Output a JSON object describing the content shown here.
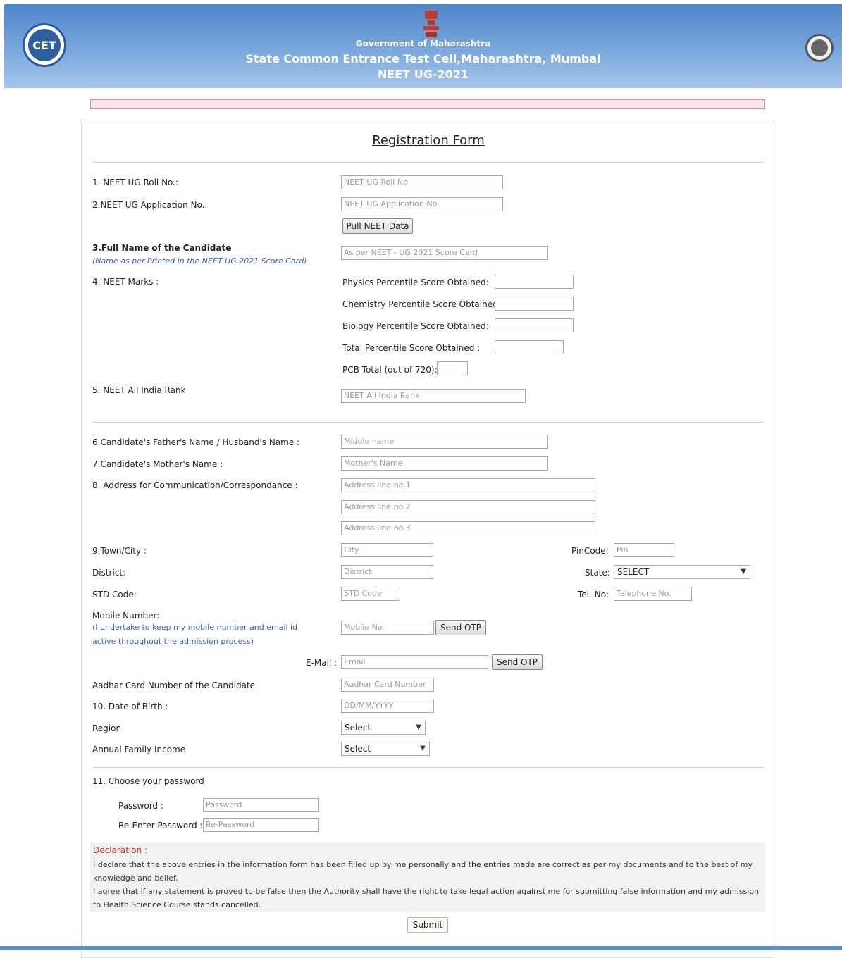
{
  "header": {
    "line1": "Government of Maharashtra",
    "line2": "State Common Entrance Test Cell,Maharashtra, Mumbai",
    "line3": "NEET UG-2021",
    "logo_text": "CET"
  },
  "form": {
    "title": "Registration Form",
    "roll_label": "1. NEET UG Roll No.:",
    "roll_placeholder": "NEET UG Roll No",
    "appno_label": "2.NEET UG Application No.:",
    "appno_placeholder": "NEET UG Application No",
    "pull_button": "Pull NEET Data",
    "fullname_label": "3.Full Name of the Candidate",
    "fullname_note": "(Name as per Printed in the NEET UG 2021 Score Card)",
    "fullname_placeholder": "As per NEET - UG 2021 Score Card",
    "marks_label": "4. NEET Marks :",
    "physics_label": "Physics Percentile Score Obtained:",
    "chemistry_label": "Chemistry Percentile Score Obtained:",
    "biology_label": "Biology Percentile Score Obtained:",
    "total_label": "Total Percentile Score Obtained :",
    "pcb_label": "PCB Total (out of 720):",
    "rank_label": "5. NEET All India Rank",
    "rank_placeholder": "NEET All India Rank",
    "father_label": "6.Candidate's Father's Name / Husband's Name :",
    "father_placeholder": "Middle name",
    "mother_label": "7.Candidate's Mother's Name :",
    "mother_placeholder": "Mother's Name",
    "address_label": "8. Address for Communication/Correspondance :",
    "address1_placeholder": "Address line no.1",
    "address2_placeholder": "Address line no.2",
    "address3_placeholder": "Address line no.3",
    "city_label": "9.Town/City :",
    "city_placeholder": "City",
    "pincode_label": "PinCode:",
    "pincode_placeholder": "Pin",
    "district_label": "District:",
    "district_placeholder": "District",
    "state_label": "State:",
    "state_value": "SELECT",
    "std_label": "STD Code:",
    "std_placeholder": "STD Code",
    "tel_label": "Tel. No:",
    "tel_placeholder": "Telephone No.",
    "mobile_label": "Mobile Number:",
    "mobile_note": "(I undertake to keep my mobile number and email id active throughout the admission process)",
    "mobile_placeholder": "Mobile No.",
    "send_otp": "Send OTP",
    "email_label": "E-Mail :",
    "email_placeholder": "Email",
    "aadhar_label": "Aadhar Card Number of the Candidate",
    "aadhar_placeholder": "Aadhar Card Number",
    "dob_label": "10. Date of Birth :",
    "dob_placeholder": "DD/MM/YYYY",
    "region_label": "Region",
    "region_value": "Select",
    "income_label": "Annual Family Income",
    "income_value": "Select",
    "password_section": "11. Choose your password",
    "password_label": "Password :",
    "password_placeholder": "Password",
    "repassword_label": "Re-Enter Password :",
    "repassword_placeholder": "Re-Password",
    "declaration_head": "Declaration :",
    "declaration_text1": "I declare that the above entries in the information form has been filled up by me personally and the entries made are correct as per my documents and to the best of my knowledge and belief.",
    "declaration_text2": "I agree that if any statement is proved to be false then the Authority shall have the right to take legal action against me for submitting false information and my admission to Health Science Course stands cancelled.",
    "submit": "Submit"
  },
  "colors": {
    "header_blue": "#5a8fcf",
    "declaration_red": "#d0312d",
    "note_blue": "#3b5fb5"
  }
}
